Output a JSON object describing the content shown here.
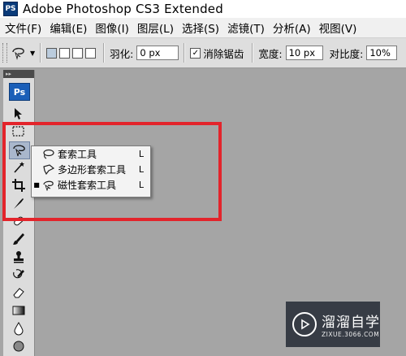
{
  "window": {
    "app_icon_text": "PS",
    "title": "Adobe Photoshop CS3 Extended"
  },
  "menubar": {
    "items": [
      "文件(F)",
      "编辑(E)",
      "图像(I)",
      "图层(L)",
      "选择(S)",
      "滤镜(T)",
      "分析(A)",
      "视图(V)"
    ]
  },
  "options": {
    "feather_label": "羽化:",
    "feather_value": "0 px",
    "antialias_label": "消除锯齿",
    "antialias_checked": "✓",
    "width_label": "宽度:",
    "width_value": "10 px",
    "contrast_label": "对比度:",
    "contrast_value": "10%"
  },
  "toolbox": {
    "header_glyph": "▸▸",
    "badge": "Ps"
  },
  "flyout": {
    "items": [
      {
        "label": "套索工具",
        "shortcut": "L",
        "active": ""
      },
      {
        "label": "多边形套索工具",
        "shortcut": "L",
        "active": ""
      },
      {
        "label": "磁性套索工具",
        "shortcut": "L",
        "active": "■"
      }
    ]
  },
  "watermark": {
    "name": "溜溜自学",
    "url": "ZIXUE.3066.COM"
  },
  "colors": {
    "highlight_box": "#e3242b",
    "canvas": "#a5a5a5"
  }
}
